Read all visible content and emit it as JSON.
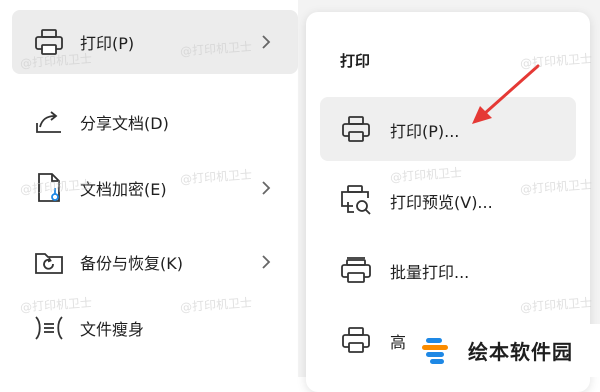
{
  "left_menu": {
    "items": [
      {
        "label": "打印(P)",
        "icon": "printer-icon",
        "has_submenu": true,
        "active": true
      },
      {
        "label": "分享文档(D)",
        "icon": "share-icon",
        "has_submenu": false
      },
      {
        "label": "文档加密(E)",
        "icon": "document-lock-icon",
        "has_submenu": true
      },
      {
        "label": "备份与恢复(K)",
        "icon": "backup-folder-icon",
        "has_submenu": true
      },
      {
        "label": "文件瘦身",
        "icon": "compress-icon",
        "has_submenu": false
      }
    ]
  },
  "submenu": {
    "title": "打印",
    "items": [
      {
        "label": "打印(P)...",
        "icon": "printer-icon",
        "hover": true
      },
      {
        "label": "打印预览(V)...",
        "icon": "print-preview-icon"
      },
      {
        "label": "批量打印...",
        "icon": "batch-print-icon"
      },
      {
        "label": "高",
        "icon": "printer-icon"
      }
    ]
  },
  "watermark": "@打印机卫士",
  "brand": {
    "name": "绘本软件园"
  },
  "colors": {
    "arrow": "#e53935",
    "brand_blue": "#1e88e5",
    "brand_orange": "#fb8c00"
  }
}
